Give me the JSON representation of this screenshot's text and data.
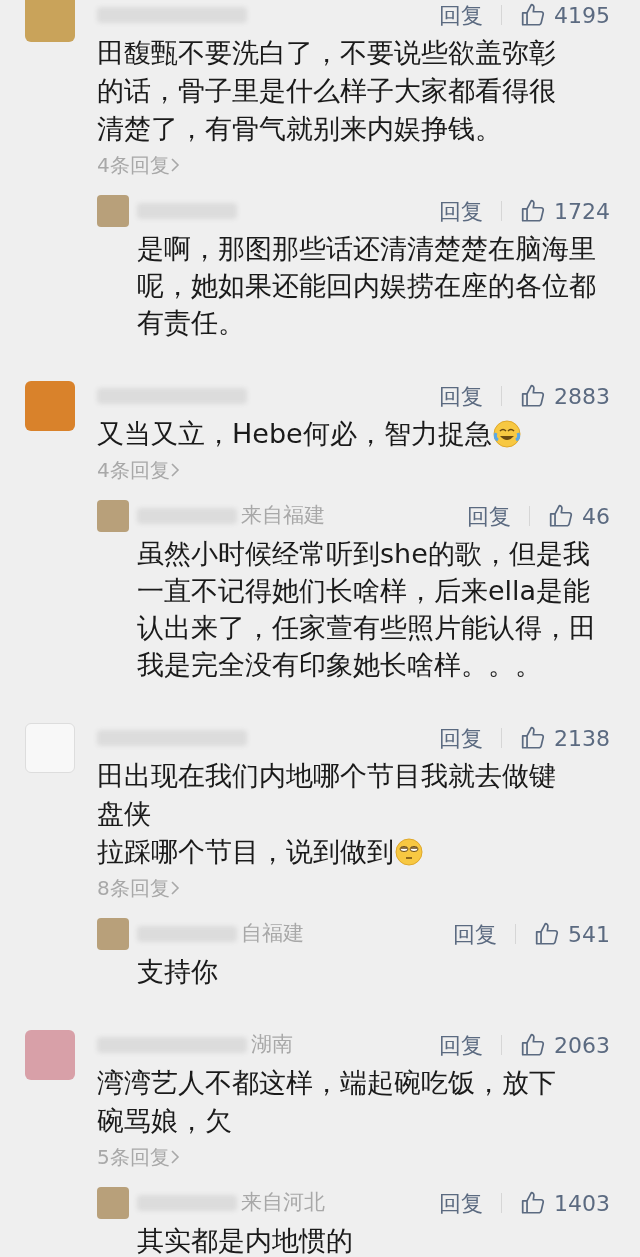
{
  "comments": [
    {
      "text": "田馥甄不要洗白了，不要说些欲盖弥彰的话，骨子里是什么样子大家都看得很清楚了，有骨气就别来内娱挣钱。",
      "reply_label": "回复",
      "likes": "4195",
      "replies_link": "4条回复",
      "reply": {
        "text": "是啊，那图那些话还清清楚楚在脑海里呢，她如果还能回内娱捞在座的各位都有责任。",
        "reply_label": "回复",
        "likes": "1724"
      }
    },
    {
      "text": "又当又立，Hebe何必，智力捉急",
      "emoji": {
        "kind": "laughcry"
      },
      "reply_label": "回复",
      "likes": "2883",
      "replies_link": "4条回复",
      "reply": {
        "meta": "来自福建",
        "text": "虽然小时候经常听到she的歌，但是我一直不记得她们长啥样，后来ella是能认出来了，任家萱有些照片能认得，田我是完全没有印象她长啥样。。。",
        "reply_label": "回复",
        "likes": "46"
      }
    },
    {
      "lines": [
        "田出现在我们内地哪个节目我就去做键盘侠",
        "拉踩哪个节目，说到做到"
      ],
      "emoji": {
        "kind": "eyeroll"
      },
      "reply_label": "回复",
      "likes": "2138",
      "replies_link": "8条回复",
      "reply": {
        "meta": "自福建",
        "text": "支持你",
        "reply_label": "回复",
        "likes": "541"
      }
    },
    {
      "meta": "湖南",
      "text": "湾湾艺人不都这样，端起碗吃饭，放下碗骂娘，欠",
      "reply_label": "回复",
      "likes": "2063",
      "replies_link": "5条回复",
      "reply": {
        "meta": "来自河北",
        "text": "其实都是内地惯的",
        "reply_label": "回复",
        "likes": "1403"
      }
    }
  ]
}
